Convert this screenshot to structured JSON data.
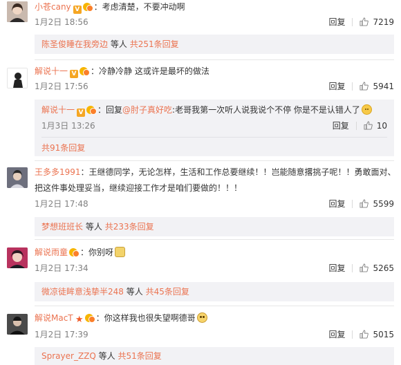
{
  "comments": [
    {
      "username": "小苍cany",
      "badge": "V",
      "content": "：考虑清楚，不要冲动啊",
      "time": "1月2日 18:56",
      "reply_label": "回复",
      "likes": "7219",
      "more": {
        "user": "陈圣俊睡在我旁边",
        "text": "等人",
        "count": "共251条回复"
      },
      "avatar_color": "#5a4a45"
    },
    {
      "username": "解说十一",
      "badge": "V",
      "content": "：冷静冷静 这或许是最坏的做法",
      "time": "1月2日 17:56",
      "reply_label": "回复",
      "likes": "5941",
      "sub": {
        "username": "解说十一",
        "badge": "V",
        "prefix": "：回复",
        "mention": "@肘子真好吃",
        "content": ":老哥我第一次听人说我说个不停 你是不是认错人了",
        "time": "1月3日 13:26",
        "reply_label": "回复",
        "likes": "10"
      },
      "more": {
        "user": "",
        "text": "",
        "count": "共91条回复"
      },
      "avatar_color": "#ffffff"
    },
    {
      "username": "王多多1991",
      "badge": "",
      "content": "：王继德同学，无论怎样，生活和工作总要继续！！岂能随意撂挑子呢！！勇敢面对、",
      "content2": "把这件事处理妥当，继续迎接工作才是咱们要做的！！！",
      "time": "1月2日 17:48",
      "reply_label": "回复",
      "likes": "5599",
      "more": {
        "user": "梦想班班长",
        "text": "等人",
        "count": "共233条回复"
      },
      "avatar_color": "#8a8a95"
    },
    {
      "username": "解说雨童",
      "badge": "",
      "content": "：你别呀",
      "time": "1月2日 17:34",
      "reply_label": "回复",
      "likes": "5265",
      "more": {
        "user": "微凉徒眸意浅挚半248",
        "text": "等人",
        "count": "共45条回复"
      },
      "avatar_color": "#c23a6a"
    },
    {
      "username": "解说MacT",
      "badge": "★",
      "content": "：你这样我也很失望啊德哥",
      "time": "1月2日 17:39",
      "reply_label": "回复",
      "likes": "5015",
      "more": {
        "user": "Sprayer_ZZQ",
        "text": "等人",
        "count": "共51条回复"
      },
      "avatar_color": "#3a3a3a"
    }
  ],
  "colors": {
    "link": "#eb7350",
    "meta": "#808080",
    "subbox": "#f2f2f5"
  }
}
